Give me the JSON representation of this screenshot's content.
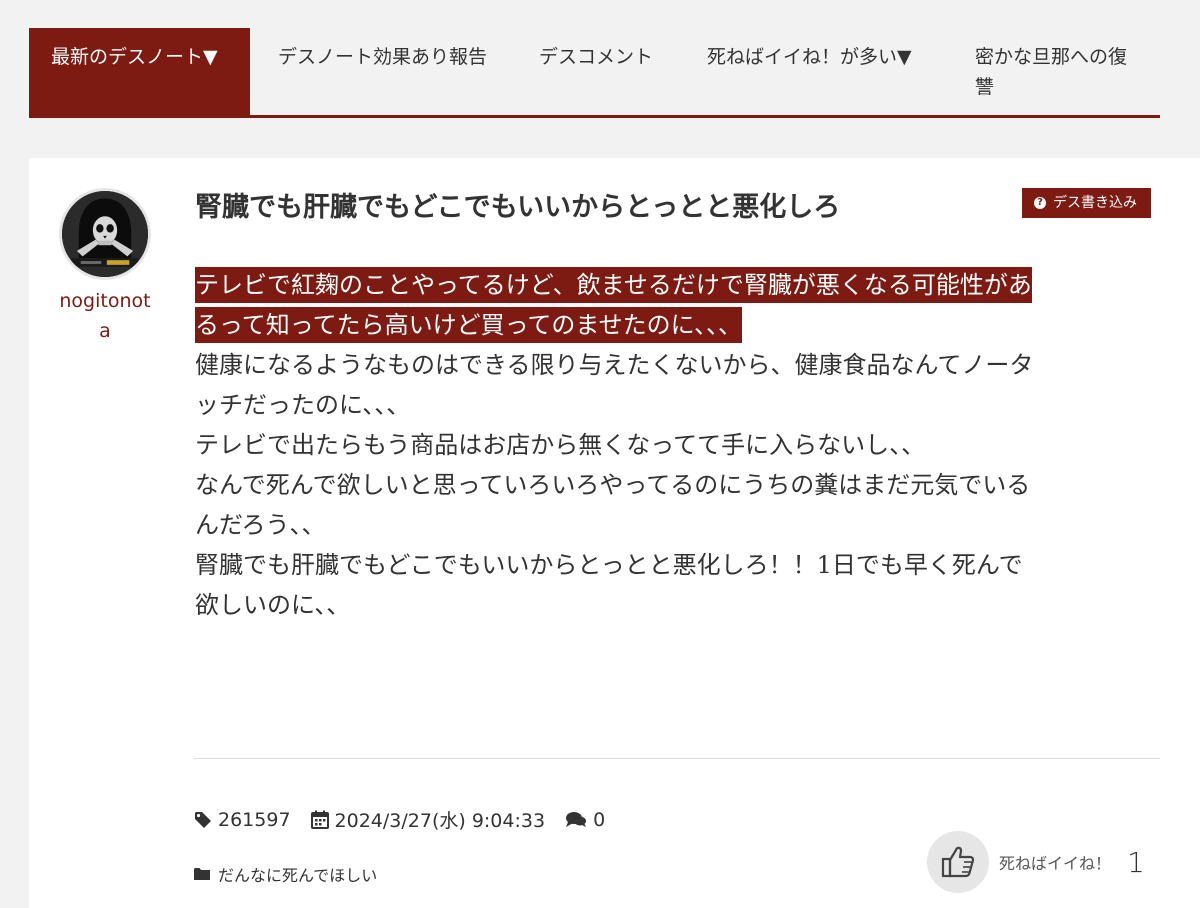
{
  "nav": {
    "items": [
      {
        "label": "最新のデスノート▼",
        "active": true
      },
      {
        "label": "デスノート効果あり報告",
        "active": false
      },
      {
        "label": "デスコメント",
        "active": false
      },
      {
        "label": "死ねばイイね！が多い▼",
        "active": false
      },
      {
        "label": "密かな旦那への復讐",
        "active": false
      }
    ]
  },
  "post": {
    "author": "nogitonota",
    "title": "腎臓でも肝臓でもどこでもいいからとっとと悪化しろ",
    "category_badge": "デス書き込み",
    "highlight_lines": [
      "テレビで紅麹のことやってるけど、飲ませるだけで腎臓が悪くなる可能性があ",
      "るって知ってたら高いけど買ってのませたのに、、、"
    ],
    "body_lines": [
      "健康になるようなものはできる限り与えたくないから、健康食品なんてノータ",
      "ッチだったのに、、、",
      "テレビで出たらもう商品はお店から無くなってて手に入らないし、、",
      "なんで死んで欲しいと思っていろいろやってるのにうちの糞はまだ元気でいる",
      "んだろう、、",
      "腎臓でも肝臓でもどこでもいいからとっとと悪化しろ！！1日でも早く死んで",
      "欲しいのに、、"
    ],
    "post_id": "261597",
    "date": "2024/3/27(水) 9:04:33",
    "comment_count": "0",
    "category": "だんなに死んでほしい",
    "like_label": "死ねばイイね！",
    "like_count": "1"
  },
  "colors": {
    "accent": "#7d1a12",
    "background": "#f2f2f2",
    "card": "#ffffff",
    "text": "#333333"
  },
  "icons": {
    "badge": "question-circle-icon",
    "post_id": "tag-icon",
    "date": "calendar-icon",
    "comments": "comments-icon",
    "category": "folder-icon",
    "like": "thumbs-up-icon"
  }
}
